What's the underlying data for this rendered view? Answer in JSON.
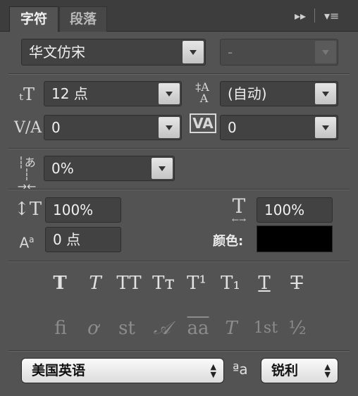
{
  "tabs": [
    {
      "label": "字符"
    },
    {
      "label": "段落"
    }
  ],
  "toolbar": {
    "expand_icon": "▸▸",
    "menu_icon": "▾≡"
  },
  "font_family": {
    "value": "华文仿宋"
  },
  "font_style": {
    "value": "-"
  },
  "font_size": {
    "value": "12 点"
  },
  "leading": {
    "value": "(自动)"
  },
  "kerning": {
    "value": "0"
  },
  "tracking": {
    "value": "0"
  },
  "tsume": {
    "value": "0%"
  },
  "vertical_scale": {
    "value": "100%"
  },
  "horizontal_scale": {
    "value": "100%"
  },
  "baseline_shift": {
    "value": "0 点"
  },
  "color": {
    "label": "颜色:",
    "swatch": "#000000"
  },
  "style_buttons": [
    {
      "glyph": "T"
    },
    {
      "glyph": "T"
    },
    {
      "glyph": "TT"
    },
    {
      "glyph": "Tт"
    },
    {
      "glyph": "T¹"
    },
    {
      "glyph": "T₁"
    },
    {
      "glyph": "T"
    },
    {
      "glyph": "T"
    }
  ],
  "opentype_buttons": [
    {
      "glyph": "ﬁ"
    },
    {
      "glyph": "ơ"
    },
    {
      "glyph": "st"
    },
    {
      "glyph": "𝒜"
    },
    {
      "glyph": "aa"
    },
    {
      "glyph": "T"
    },
    {
      "glyph": "1st"
    },
    {
      "glyph": "½"
    }
  ],
  "language": {
    "value": "美国英语"
  },
  "antialias": {
    "icon": "ªa",
    "value": "锐利"
  }
}
